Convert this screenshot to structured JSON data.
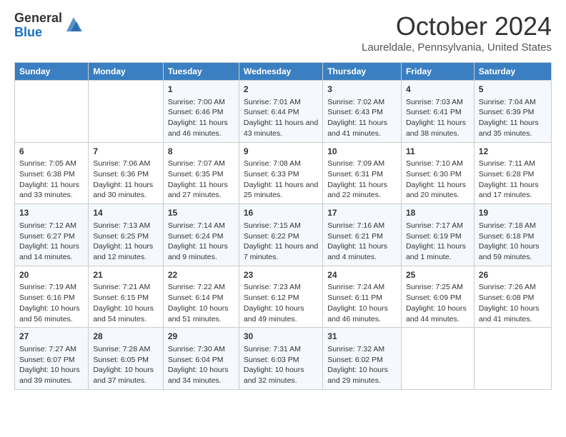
{
  "header": {
    "logo_general": "General",
    "logo_blue": "Blue",
    "month_title": "October 2024",
    "location": "Laureldale, Pennsylvania, United States"
  },
  "days_of_week": [
    "Sunday",
    "Monday",
    "Tuesday",
    "Wednesday",
    "Thursday",
    "Friday",
    "Saturday"
  ],
  "weeks": [
    [
      {
        "day": "",
        "sunrise": "",
        "sunset": "",
        "daylight": ""
      },
      {
        "day": "",
        "sunrise": "",
        "sunset": "",
        "daylight": ""
      },
      {
        "day": "1",
        "sunrise": "Sunrise: 7:00 AM",
        "sunset": "Sunset: 6:46 PM",
        "daylight": "Daylight: 11 hours and 46 minutes."
      },
      {
        "day": "2",
        "sunrise": "Sunrise: 7:01 AM",
        "sunset": "Sunset: 6:44 PM",
        "daylight": "Daylight: 11 hours and 43 minutes."
      },
      {
        "day": "3",
        "sunrise": "Sunrise: 7:02 AM",
        "sunset": "Sunset: 6:43 PM",
        "daylight": "Daylight: 11 hours and 41 minutes."
      },
      {
        "day": "4",
        "sunrise": "Sunrise: 7:03 AM",
        "sunset": "Sunset: 6:41 PM",
        "daylight": "Daylight: 11 hours and 38 minutes."
      },
      {
        "day": "5",
        "sunrise": "Sunrise: 7:04 AM",
        "sunset": "Sunset: 6:39 PM",
        "daylight": "Daylight: 11 hours and 35 minutes."
      }
    ],
    [
      {
        "day": "6",
        "sunrise": "Sunrise: 7:05 AM",
        "sunset": "Sunset: 6:38 PM",
        "daylight": "Daylight: 11 hours and 33 minutes."
      },
      {
        "day": "7",
        "sunrise": "Sunrise: 7:06 AM",
        "sunset": "Sunset: 6:36 PM",
        "daylight": "Daylight: 11 hours and 30 minutes."
      },
      {
        "day": "8",
        "sunrise": "Sunrise: 7:07 AM",
        "sunset": "Sunset: 6:35 PM",
        "daylight": "Daylight: 11 hours and 27 minutes."
      },
      {
        "day": "9",
        "sunrise": "Sunrise: 7:08 AM",
        "sunset": "Sunset: 6:33 PM",
        "daylight": "Daylight: 11 hours and 25 minutes."
      },
      {
        "day": "10",
        "sunrise": "Sunrise: 7:09 AM",
        "sunset": "Sunset: 6:31 PM",
        "daylight": "Daylight: 11 hours and 22 minutes."
      },
      {
        "day": "11",
        "sunrise": "Sunrise: 7:10 AM",
        "sunset": "Sunset: 6:30 PM",
        "daylight": "Daylight: 11 hours and 20 minutes."
      },
      {
        "day": "12",
        "sunrise": "Sunrise: 7:11 AM",
        "sunset": "Sunset: 6:28 PM",
        "daylight": "Daylight: 11 hours and 17 minutes."
      }
    ],
    [
      {
        "day": "13",
        "sunrise": "Sunrise: 7:12 AM",
        "sunset": "Sunset: 6:27 PM",
        "daylight": "Daylight: 11 hours and 14 minutes."
      },
      {
        "day": "14",
        "sunrise": "Sunrise: 7:13 AM",
        "sunset": "Sunset: 6:25 PM",
        "daylight": "Daylight: 11 hours and 12 minutes."
      },
      {
        "day": "15",
        "sunrise": "Sunrise: 7:14 AM",
        "sunset": "Sunset: 6:24 PM",
        "daylight": "Daylight: 11 hours and 9 minutes."
      },
      {
        "day": "16",
        "sunrise": "Sunrise: 7:15 AM",
        "sunset": "Sunset: 6:22 PM",
        "daylight": "Daylight: 11 hours and 7 minutes."
      },
      {
        "day": "17",
        "sunrise": "Sunrise: 7:16 AM",
        "sunset": "Sunset: 6:21 PM",
        "daylight": "Daylight: 11 hours and 4 minutes."
      },
      {
        "day": "18",
        "sunrise": "Sunrise: 7:17 AM",
        "sunset": "Sunset: 6:19 PM",
        "daylight": "Daylight: 11 hours and 1 minute."
      },
      {
        "day": "19",
        "sunrise": "Sunrise: 7:18 AM",
        "sunset": "Sunset: 6:18 PM",
        "daylight": "Daylight: 10 hours and 59 minutes."
      }
    ],
    [
      {
        "day": "20",
        "sunrise": "Sunrise: 7:19 AM",
        "sunset": "Sunset: 6:16 PM",
        "daylight": "Daylight: 10 hours and 56 minutes."
      },
      {
        "day": "21",
        "sunrise": "Sunrise: 7:21 AM",
        "sunset": "Sunset: 6:15 PM",
        "daylight": "Daylight: 10 hours and 54 minutes."
      },
      {
        "day": "22",
        "sunrise": "Sunrise: 7:22 AM",
        "sunset": "Sunset: 6:14 PM",
        "daylight": "Daylight: 10 hours and 51 minutes."
      },
      {
        "day": "23",
        "sunrise": "Sunrise: 7:23 AM",
        "sunset": "Sunset: 6:12 PM",
        "daylight": "Daylight: 10 hours and 49 minutes."
      },
      {
        "day": "24",
        "sunrise": "Sunrise: 7:24 AM",
        "sunset": "Sunset: 6:11 PM",
        "daylight": "Daylight: 10 hours and 46 minutes."
      },
      {
        "day": "25",
        "sunrise": "Sunrise: 7:25 AM",
        "sunset": "Sunset: 6:09 PM",
        "daylight": "Daylight: 10 hours and 44 minutes."
      },
      {
        "day": "26",
        "sunrise": "Sunrise: 7:26 AM",
        "sunset": "Sunset: 6:08 PM",
        "daylight": "Daylight: 10 hours and 41 minutes."
      }
    ],
    [
      {
        "day": "27",
        "sunrise": "Sunrise: 7:27 AM",
        "sunset": "Sunset: 6:07 PM",
        "daylight": "Daylight: 10 hours and 39 minutes."
      },
      {
        "day": "28",
        "sunrise": "Sunrise: 7:28 AM",
        "sunset": "Sunset: 6:05 PM",
        "daylight": "Daylight: 10 hours and 37 minutes."
      },
      {
        "day": "29",
        "sunrise": "Sunrise: 7:30 AM",
        "sunset": "Sunset: 6:04 PM",
        "daylight": "Daylight: 10 hours and 34 minutes."
      },
      {
        "day": "30",
        "sunrise": "Sunrise: 7:31 AM",
        "sunset": "Sunset: 6:03 PM",
        "daylight": "Daylight: 10 hours and 32 minutes."
      },
      {
        "day": "31",
        "sunrise": "Sunrise: 7:32 AM",
        "sunset": "Sunset: 6:02 PM",
        "daylight": "Daylight: 10 hours and 29 minutes."
      },
      {
        "day": "",
        "sunrise": "",
        "sunset": "",
        "daylight": ""
      },
      {
        "day": "",
        "sunrise": "",
        "sunset": "",
        "daylight": ""
      }
    ]
  ]
}
